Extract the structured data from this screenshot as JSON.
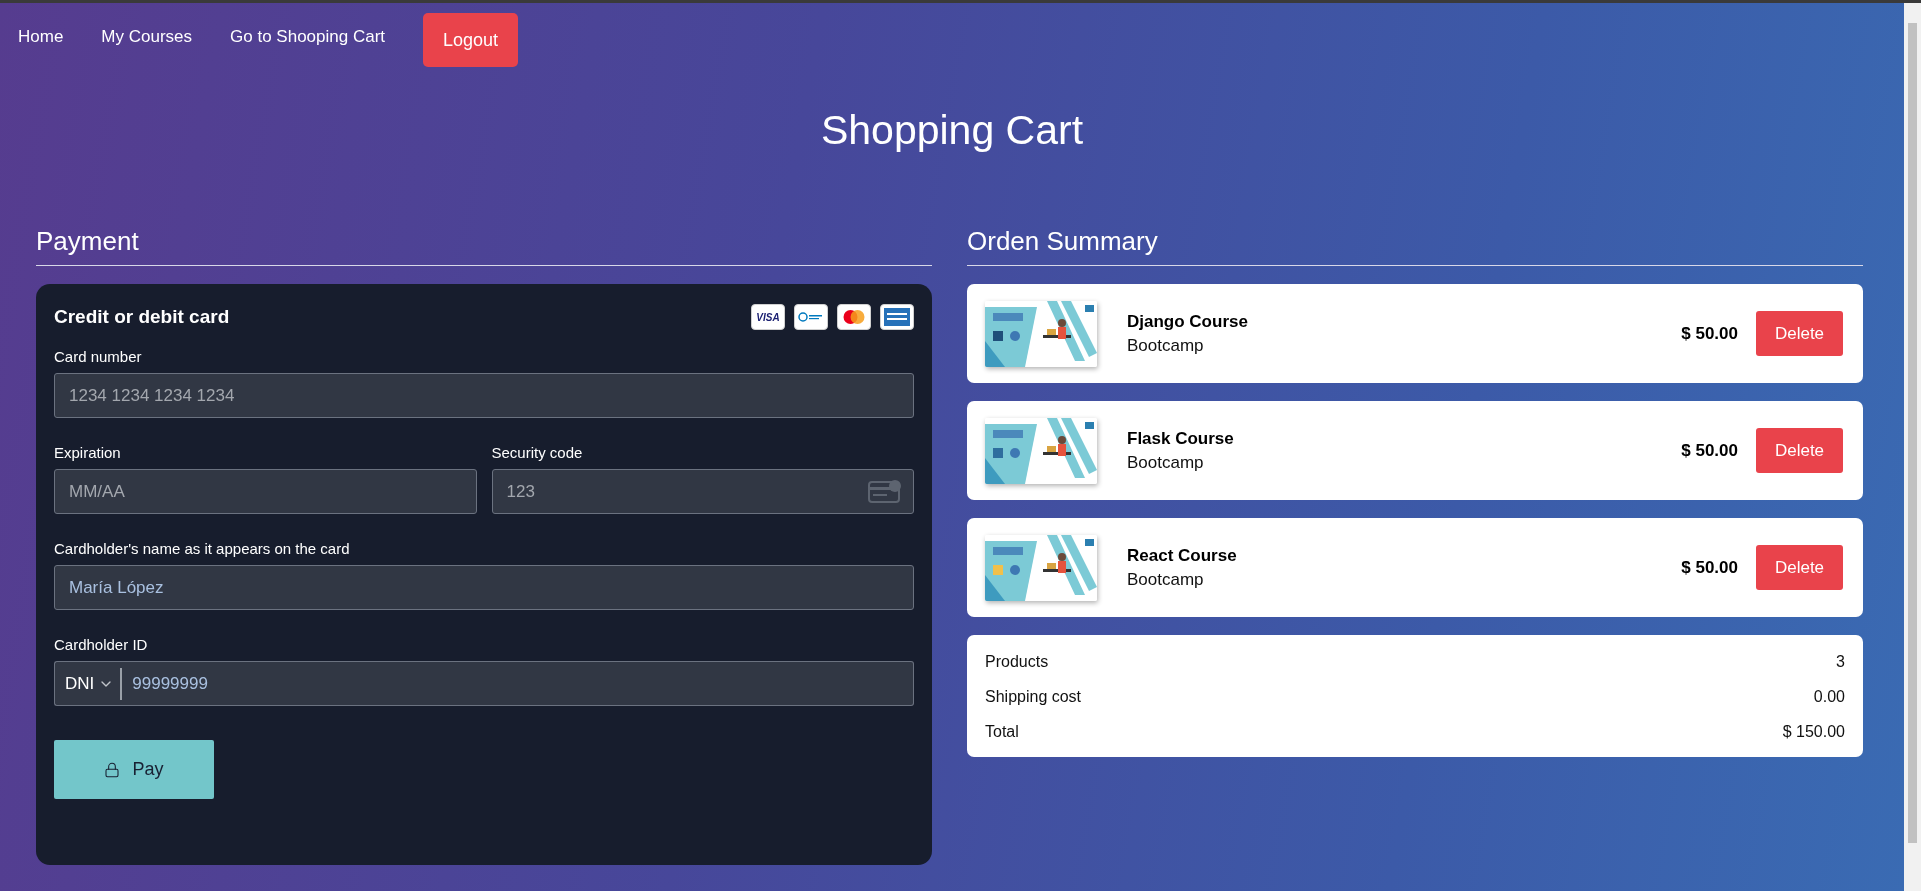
{
  "nav": {
    "links": [
      {
        "label": "Home"
      },
      {
        "label": "My Courses"
      },
      {
        "label": "Go to Shooping Cart"
      }
    ],
    "logout": "Logout"
  },
  "title": "Shopping Cart",
  "payment": {
    "heading": "Payment",
    "card_title": "Credit or debit card",
    "brands": [
      {
        "kind": "visa",
        "label": "VISA"
      },
      {
        "kind": "diners"
      },
      {
        "kind": "mastercard"
      },
      {
        "kind": "amex"
      }
    ],
    "card_number": {
      "label": "Card number",
      "placeholder": "1234 1234 1234 1234"
    },
    "expiration": {
      "label": "Expiration",
      "placeholder": "MM/AA"
    },
    "security_code": {
      "label": "Security code",
      "placeholder": "123"
    },
    "cardholder_name": {
      "label": "Cardholder's name as it appears on the card",
      "placeholder": "María López"
    },
    "cardholder_id": {
      "label": "Cardholder ID",
      "id_type": "DNI",
      "placeholder": "99999999"
    },
    "pay": "Pay"
  },
  "summary": {
    "heading": "Orden Summary",
    "items": [
      {
        "name": "Django Course",
        "subtitle": "Bootcamp",
        "price": "$ 50.00",
        "delete": "Delete"
      },
      {
        "name": "Flask Course",
        "subtitle": "Bootcamp",
        "price": "$ 50.00",
        "delete": "Delete"
      },
      {
        "name": "React Course",
        "subtitle": "Bootcamp",
        "price": "$ 50.00",
        "delete": "Delete"
      }
    ],
    "totals": [
      {
        "label": "Products",
        "value": "3"
      },
      {
        "label": "Shipping cost",
        "value": "0.00"
      },
      {
        "label": "Total",
        "value": "$ 150.00"
      }
    ]
  }
}
